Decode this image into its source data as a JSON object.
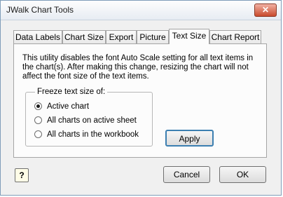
{
  "window": {
    "title": "JWalk Chart Tools",
    "close_glyph": "✕"
  },
  "tabs": [
    {
      "label": "Data Labels"
    },
    {
      "label": "Chart Size"
    },
    {
      "label": "Export"
    },
    {
      "label": "Picture"
    },
    {
      "label": "Text Size",
      "active": true
    },
    {
      "label": "Chart Report"
    }
  ],
  "panel": {
    "description": "This utility disables the font Auto Scale setting for all text items in the chart(s). After making this change, resizing the chart will not affect the font size of the text items.",
    "group_label": "Freeze text size of:",
    "options": [
      {
        "label": "Active chart",
        "selected": true
      },
      {
        "label": "All charts on active sheet",
        "selected": false
      },
      {
        "label": "All charts in the workbook",
        "selected": false
      }
    ],
    "apply_label": "Apply"
  },
  "footer": {
    "help_glyph": "?",
    "cancel_label": "Cancel",
    "ok_label": "OK"
  }
}
